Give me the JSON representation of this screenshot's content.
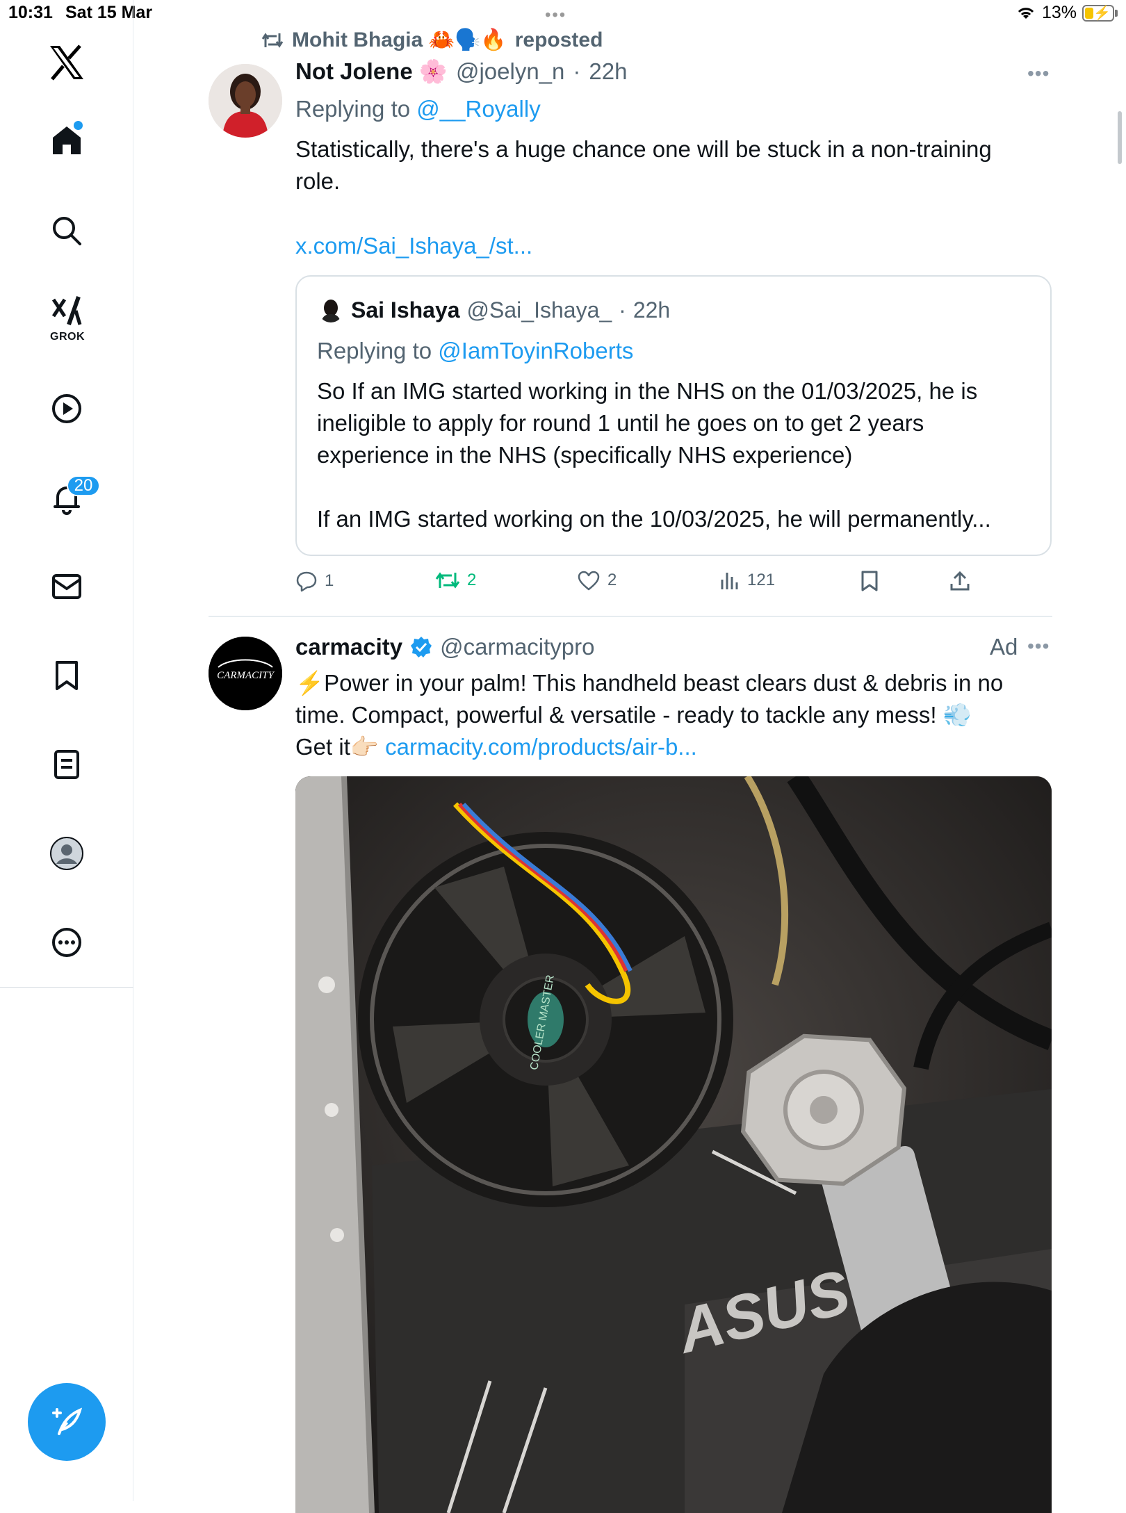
{
  "status_bar": {
    "time": "10:31",
    "date": "Sat 15 Mar",
    "battery": "13%"
  },
  "sidebar": {
    "grok_label": "GROK",
    "notifications_count": "20"
  },
  "colors": {
    "accent": "#1d9bf0",
    "repost_green": "#00ba7c",
    "text": "#0f1419",
    "muted": "#536471"
  },
  "tweet1": {
    "reposter": "Mohit Bhagia 🦀🗣️🔥",
    "reposted_label": "reposted",
    "author_name": "Not Jolene 🌸",
    "handle": "@joelyn_n",
    "time": "22h",
    "replying_to_label": "Replying to",
    "replying_to": "@__Royally",
    "text_line1": "Statistically, there's a huge chance one will be stuck in a non-training",
    "text_line2": "role.",
    "link": "x.com/Sai_Ishaya_/st...",
    "quote": {
      "author_name": "Sai Ishaya",
      "handle": "@Sai_Ishaya_",
      "time": "22h",
      "replying_to_label": "Replying to",
      "replying_to": "@IamToyinRoberts",
      "line1": "So If an IMG started working in the NHS on the 01/03/2025, he is",
      "line2": "ineligible to apply for round 1 until he goes on to get 2 years",
      "line3": "experience in the NHS (specifically NHS experience)",
      "line4": "If an IMG started working on the 10/03/2025, he will permanently..."
    },
    "actions": {
      "replies": "1",
      "reposts": "2",
      "likes": "2",
      "views": "121"
    }
  },
  "tweet2": {
    "author_name": "carmacity",
    "handle": "@carmacitypro",
    "ad_label": "Ad",
    "avatar_text": "CARMACITY",
    "line1": "⚡Power in your palm! This handheld beast clears dust & debris in no",
    "line2": "time. Compact, powerful & versatile - ready to tackle any mess! 💨",
    "line3_prefix": "Get it👉🏻",
    "link": "carmacity.com/products/air-b...",
    "media_brand_text": "ASUS",
    "fan_label": "COOLER MASTER"
  }
}
